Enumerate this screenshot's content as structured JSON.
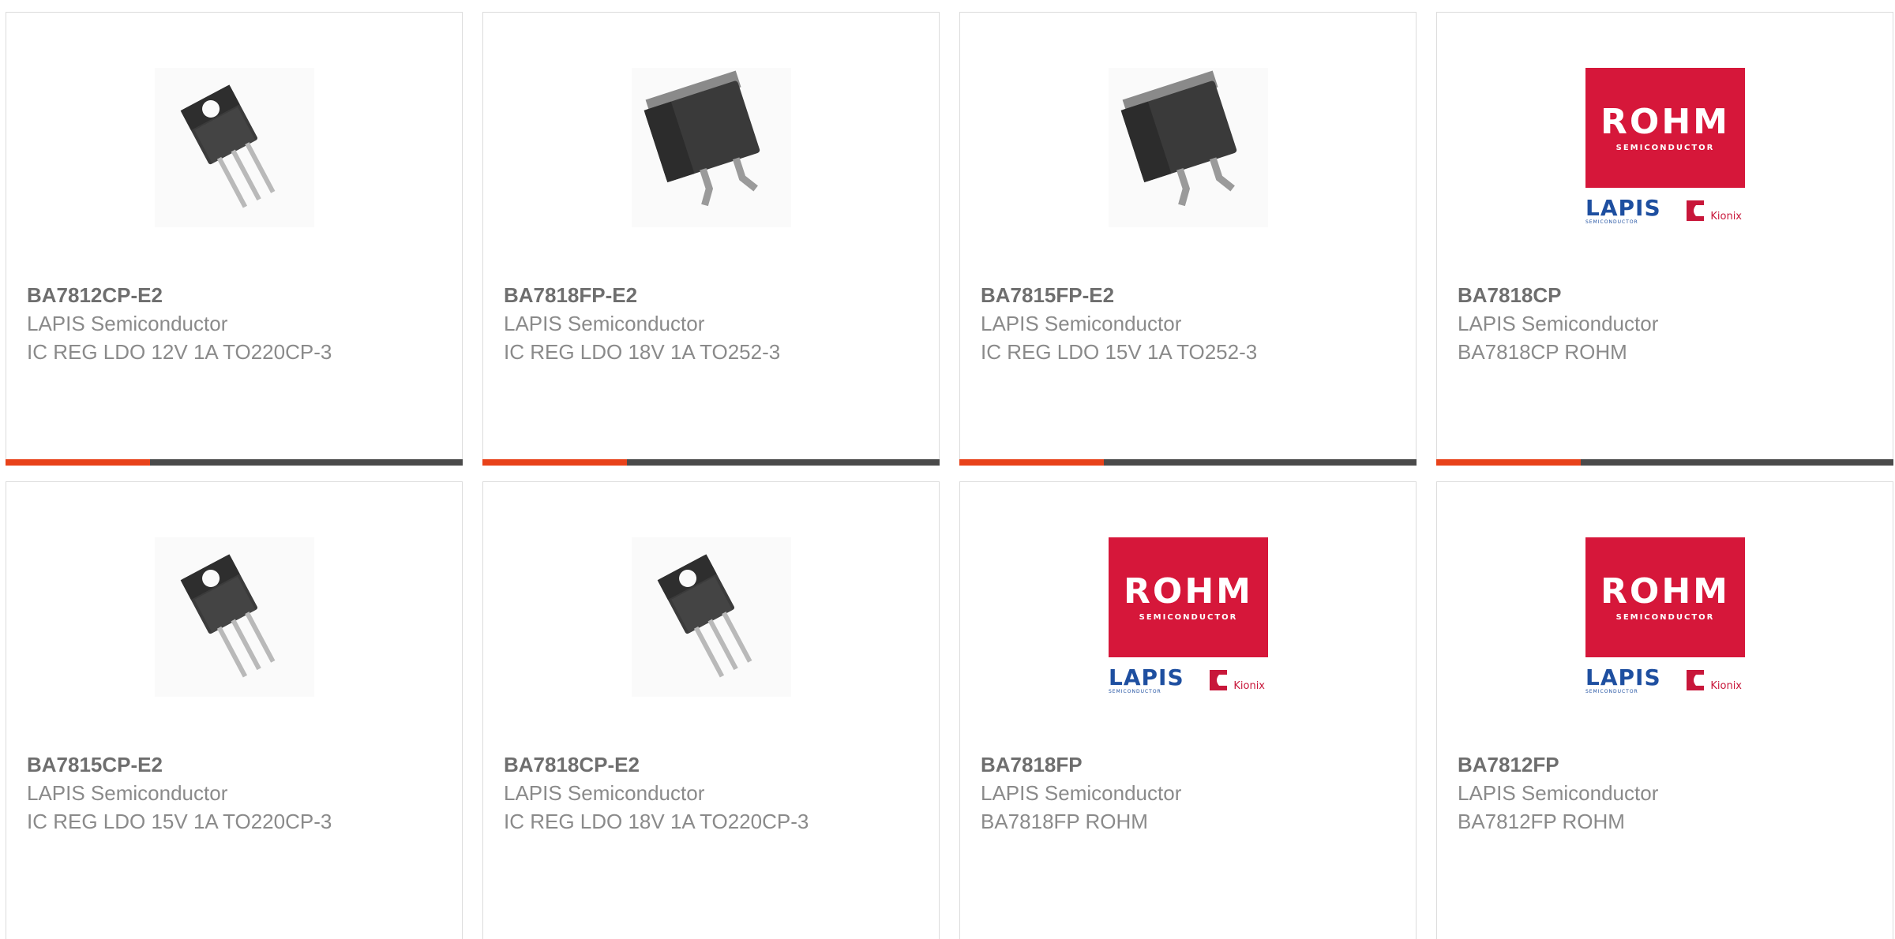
{
  "products": [
    {
      "part_number": "BA7812CP-E2",
      "manufacturer": "LAPIS Semiconductor",
      "description": "IC REG LDO 12V 1A TO220CP-3",
      "image": "to220-package-icon"
    },
    {
      "part_number": "BA7818FP-E2",
      "manufacturer": "LAPIS Semiconductor",
      "description": "IC REG LDO 18V 1A TO252-3",
      "image": "to252-package-icon"
    },
    {
      "part_number": "BA7815FP-E2",
      "manufacturer": "LAPIS Semiconductor",
      "description": "IC REG LDO 15V 1A TO252-3",
      "image": "to252-package-icon"
    },
    {
      "part_number": "BA7818CP",
      "manufacturer": "LAPIS Semiconductor",
      "description": "BA7818CP ROHM",
      "image": "rohm-logo"
    },
    {
      "part_number": "BA7815CP-E2",
      "manufacturer": "LAPIS Semiconductor",
      "description": "IC REG LDO 15V 1A TO220CP-3",
      "image": "to220-package-icon"
    },
    {
      "part_number": "BA7818CP-E2",
      "manufacturer": "LAPIS Semiconductor",
      "description": "IC REG LDO 18V 1A TO220CP-3",
      "image": "to220-package-icon"
    },
    {
      "part_number": "BA7818FP",
      "manufacturer": "LAPIS Semiconductor",
      "description": "BA7818FP ROHM",
      "image": "rohm-logo"
    },
    {
      "part_number": "BA7812FP",
      "manufacturer": "LAPIS Semiconductor",
      "description": "BA7812FP ROHM",
      "image": "rohm-logo"
    }
  ],
  "logo": {
    "rohm": "ROHM",
    "rohm_sub": "SEMICONDUCTOR",
    "lapis": "LAPIS",
    "lapis_sub": "SEMICONDUCTOR",
    "kionix": "Kionix"
  },
  "colors": {
    "accent": "#e8421a",
    "bar": "#4a4a4a",
    "rohm_red": "#d6173a",
    "lapis_blue": "#1e4fa0",
    "part_number": "#6e6e6e",
    "text": "#8a8a8a"
  }
}
